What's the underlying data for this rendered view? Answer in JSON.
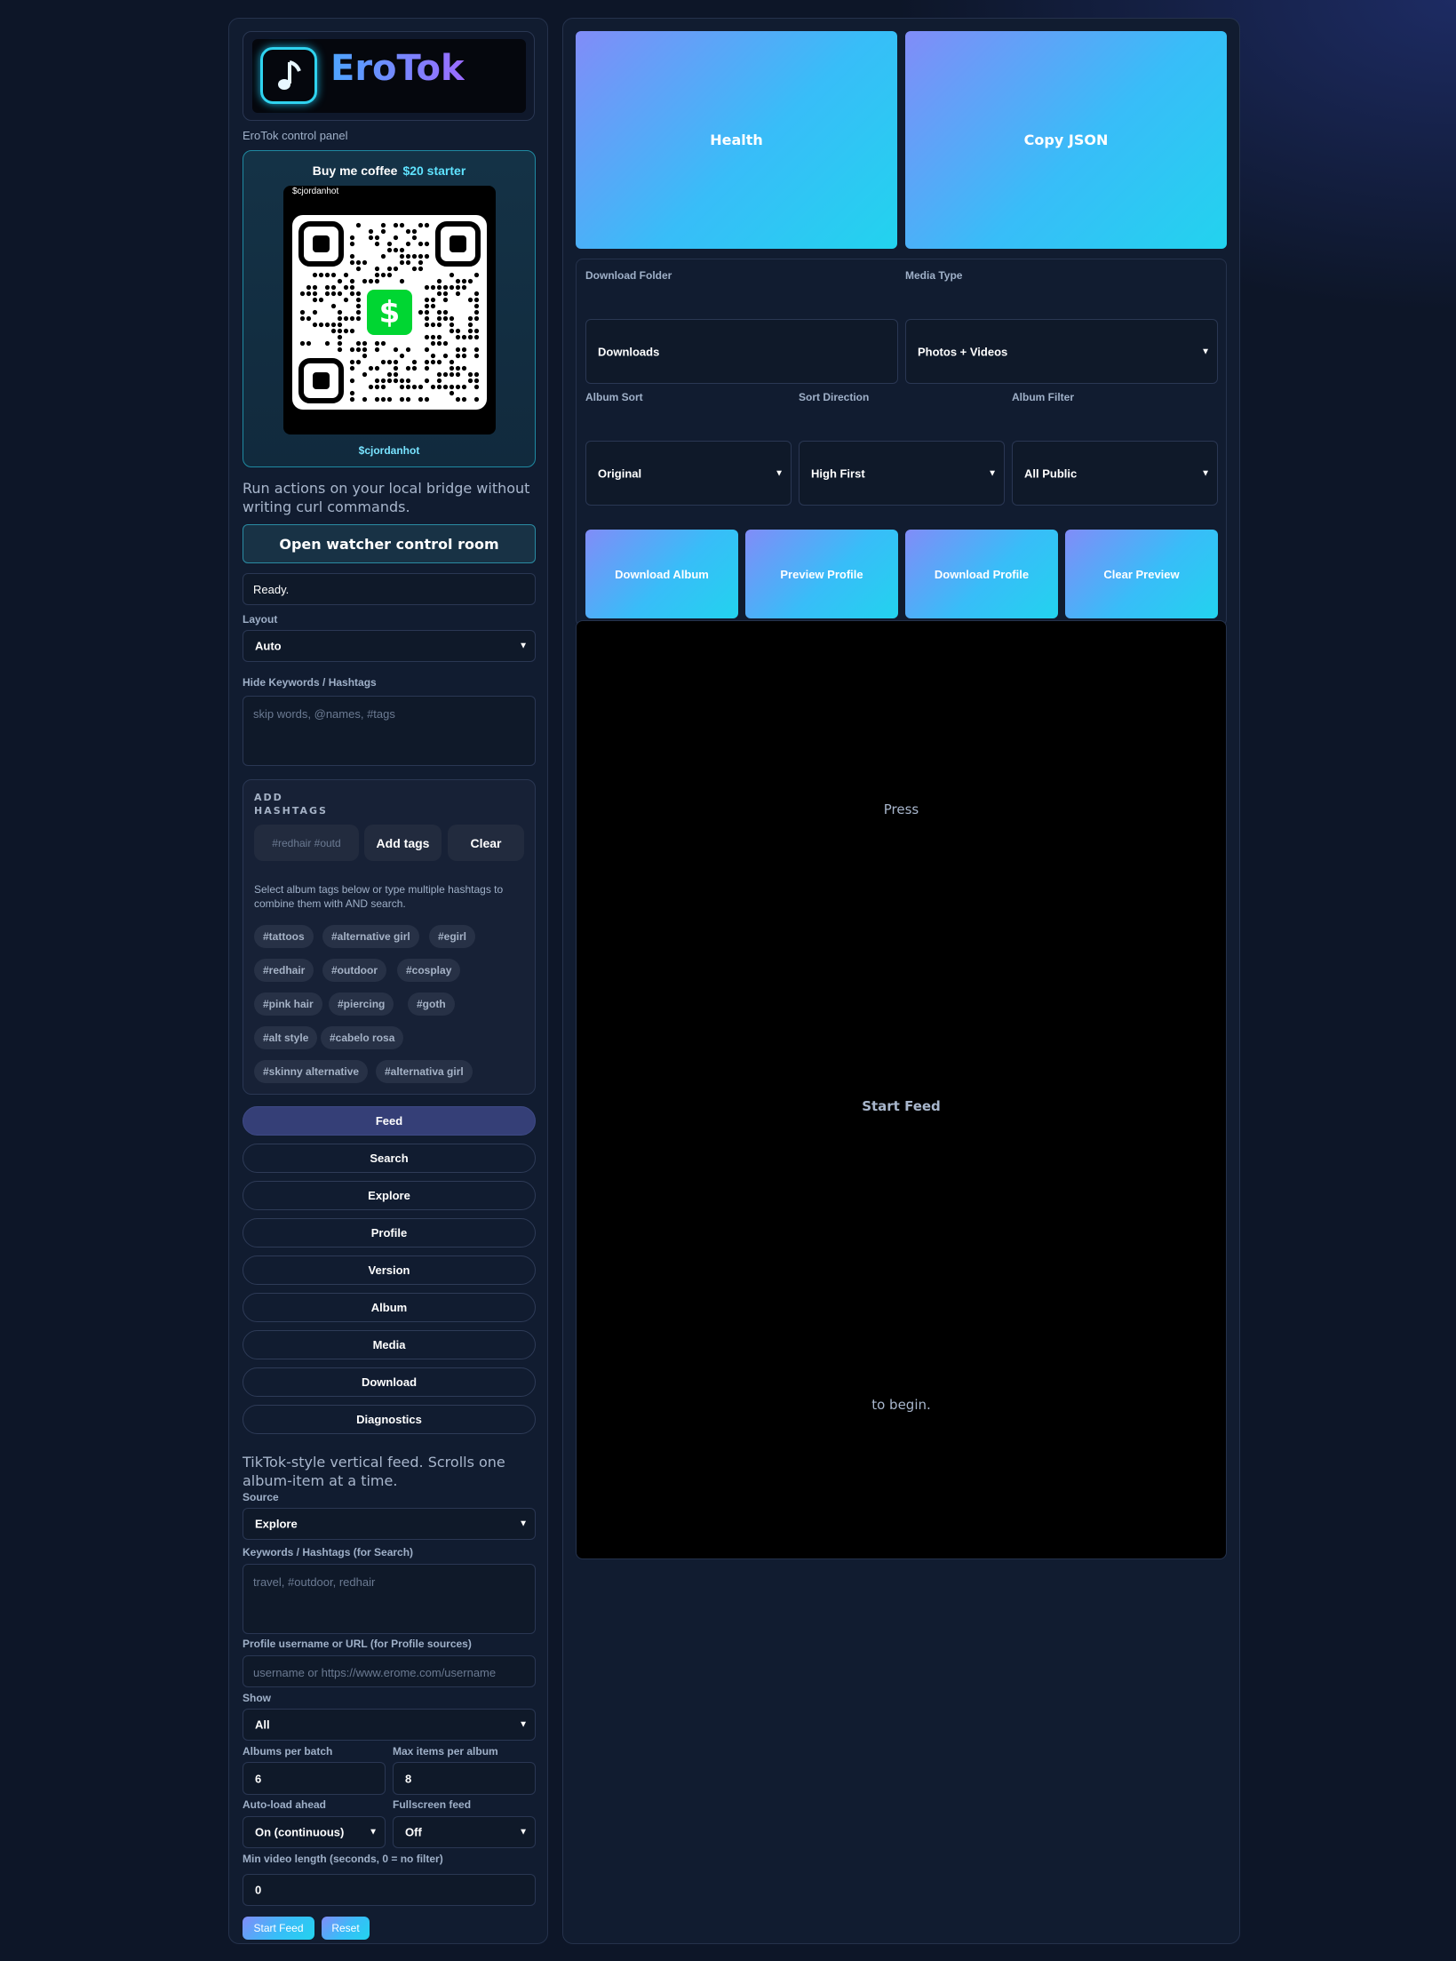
{
  "brand": {
    "logo_text": "EroTok",
    "subtitle": "EroTok control panel"
  },
  "coffee": {
    "title": "Buy me coffee",
    "amount": "$20 starter",
    "qr_handle": "$cjordanhot",
    "handle": "$cjordanhot"
  },
  "intro": "Run actions on your local bridge without writing curl commands.",
  "watcher_button": "Open watcher control room",
  "status": "Ready.",
  "layout": {
    "label": "Layout",
    "value": "Auto"
  },
  "hide_keywords": {
    "label": "Hide Keywords / Hashtags",
    "placeholder": "skip words, @names, #tags"
  },
  "add_hashtags": {
    "title_line1": "ADD",
    "title_line2": "HASHTAGS",
    "input_placeholder": "#redhair #outd",
    "add_label": "Add tags",
    "clear_label": "Clear",
    "help": "Select album tags below or type multiple hashtags to combine them with AND search.",
    "tags": [
      "#tattoos",
      "#alternative girl",
      "#egirl",
      "#redhair",
      "#outdoor",
      "#cosplay",
      "#pink hair",
      "#piercing",
      "#goth",
      "#alt style",
      "#cabelo rosa",
      "#skinny alternative",
      "#alternativa girl"
    ]
  },
  "nav": [
    "Feed",
    "Search",
    "Explore",
    "Profile",
    "Version",
    "Album",
    "Media",
    "Download",
    "Diagnostics"
  ],
  "nav_active": "Feed",
  "feed_desc": "TikTok-style vertical feed. Scrolls one album-item at a time.",
  "form": {
    "source_label": "Source",
    "source_value": "Explore",
    "keywords_label": "Keywords / Hashtags (for Search)",
    "keywords_placeholder": "travel, #outdoor, redhair",
    "profile_label": "Profile username or URL (for Profile sources)",
    "profile_placeholder": "username or https://www.erome.com/username",
    "show_label": "Show",
    "show_value": "All",
    "albums_label": "Albums per batch",
    "albums_value": "6",
    "max_label": "Max items per album",
    "max_value": "8",
    "autoload_label": "Auto-load ahead",
    "autoload_value": "On (continuous)",
    "fullscreen_label": "Fullscreen feed",
    "fullscreen_value": "Off",
    "minlen_label": "Min video length (seconds, 0 = no filter)",
    "minlen_value": "0",
    "start_label": "Start Feed",
    "reset_label": "Reset"
  },
  "right": {
    "health_label": "Health",
    "copy_json_label": "Copy JSON",
    "download_folder_label": "Download Folder",
    "download_folder_value": "Downloads",
    "media_type_label": "Media Type",
    "media_type_value": "Photos + Videos",
    "album_sort_label": "Album Sort",
    "album_sort_value": "Original",
    "sort_dir_label": "Sort Direction",
    "sort_dir_value": "High First",
    "album_filter_label": "Album Filter",
    "album_filter_value": "All Public",
    "actions": [
      "Download Album",
      "Preview Profile",
      "Download Profile",
      "Clear Preview"
    ],
    "preview_line1": "Press",
    "preview_line2": "Start Feed",
    "preview_line3": "to begin."
  },
  "colors": {
    "accent_gradient_start": "#818cf8",
    "accent_gradient_end": "#22d3ee",
    "cashapp_green": "#00d632",
    "logo_cyan": "#2fd3ef"
  }
}
